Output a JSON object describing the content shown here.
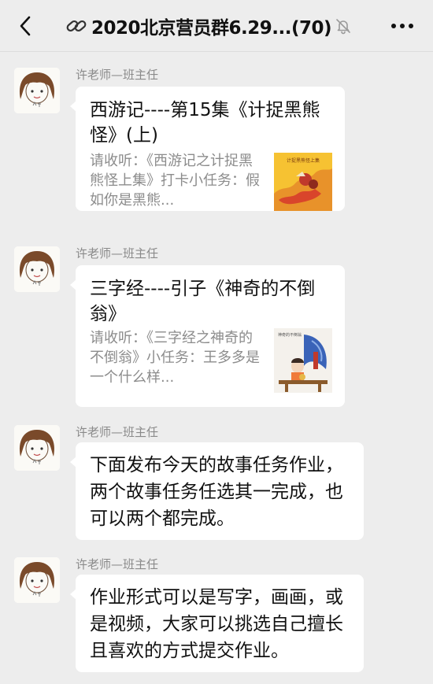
{
  "header": {
    "title": "2020北京营员群6.29...(70)",
    "back_icon": "chevron-left-icon",
    "link_icon": "link-icon",
    "mute_icon": "muted-bell-icon",
    "more_icon": "more-dots-icon"
  },
  "messages": [
    {
      "sender": "许老师—班主任",
      "type": "card",
      "title": "西游记----第15集《计捉黑熊怪》(上)",
      "description": "请收听：《西游记之计捉黑熊怪上集》打卡小任务：假如你是黑熊...",
      "thumbnail": "journey-west-thumbnail",
      "thumbnail_label": "计捉黑熊怪上集"
    },
    {
      "sender": "许老师—班主任",
      "type": "card",
      "title": "三字经----引子《神奇的不倒翁》",
      "description": "请收听：《三字经之神奇的不倒翁》小任务：王多多是一个什么样...",
      "thumbnail": "three-character-classic-thumbnail",
      "thumbnail_label": "神奇的不倒翁"
    },
    {
      "sender": "许老师—班主任",
      "type": "text",
      "text": "下面发布今天的故事任务作业，两个故事任务任选其一完成，也可以两个都完成。"
    },
    {
      "sender": "许老师—班主任",
      "type": "text",
      "text": "作业形式可以是写字，画画，或是视频，大家可以挑选自己擅长且喜欢的方式提交作业。"
    }
  ],
  "colors": {
    "background": "#ededed",
    "bubble": "#ffffff",
    "sender_text": "#8a8a8a",
    "description_text": "#8c8c8c"
  }
}
